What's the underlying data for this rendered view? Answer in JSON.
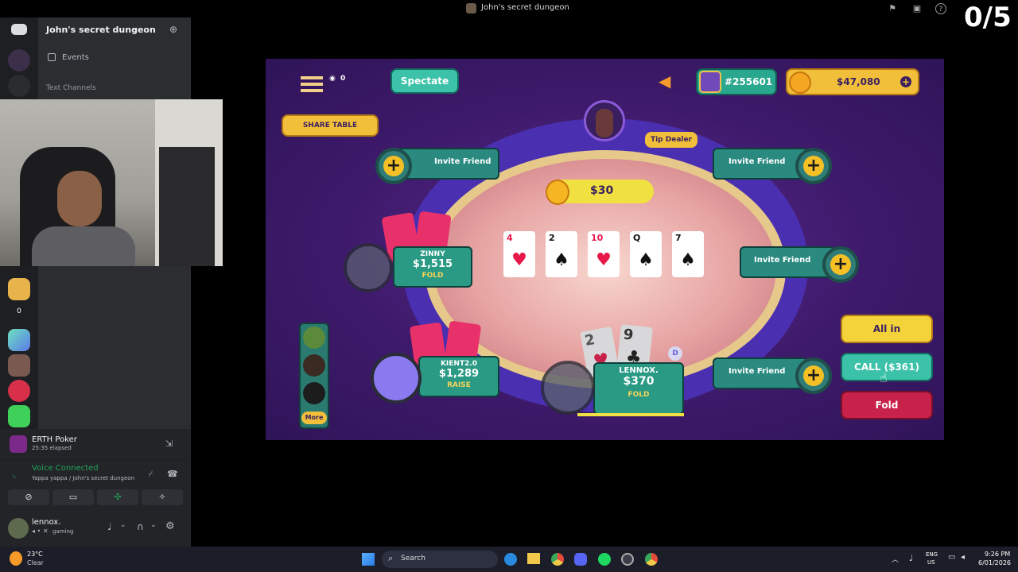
{
  "window": {
    "title": "John's secret dungeon"
  },
  "overlay": {
    "counter": "0/5"
  },
  "discord": {
    "server_name": "John's secret dungeon",
    "events_label": "Events",
    "text_channels_label": "Text Channels",
    "activity": {
      "name": "ERTH Poker",
      "elapsed": "25:35 elapsed"
    },
    "voice": {
      "status": "Voice Connected",
      "channel": "Yappa yappa / John's secret dungeon"
    },
    "user": {
      "name": "lennox.",
      "status": "gaming"
    },
    "rail_count": "0"
  },
  "game": {
    "spectate_label": "Spectate",
    "spectators": "0",
    "share_table_label": "SHARE TABLE",
    "rank": "#255601",
    "balance": "$47,080",
    "tip_dealer_label": "Tip Dealer",
    "pot": "$30",
    "invite_label": "Invite Friend",
    "more_label": "More",
    "community_cards": [
      {
        "rank": "4",
        "suit": "♥",
        "color": "#e8184a"
      },
      {
        "rank": "2",
        "suit": "♠",
        "color": "#111111"
      },
      {
        "rank": "10",
        "suit": "♥",
        "color": "#e8184a"
      },
      {
        "rank": "Q",
        "suit": "♠",
        "color": "#111111"
      },
      {
        "rank": "7",
        "suit": "♠",
        "color": "#111111"
      }
    ],
    "players": {
      "zinny": {
        "name": "ZINNY",
        "stack": "$1,515",
        "action": "FOLD"
      },
      "kient": {
        "name": "KIENT2.0",
        "stack": "$1,289",
        "action": "RAISE"
      },
      "lennox": {
        "name": "LENNOX.",
        "stack": "$370",
        "action": "FOLD",
        "dealer": "D",
        "hand": [
          {
            "rank": "2",
            "suit": "♥"
          },
          {
            "rank": "9",
            "suit": "♣"
          }
        ]
      }
    },
    "actions": {
      "all_in": "All in",
      "call": "CALL ($361)",
      "fold": "Fold"
    }
  },
  "taskbar": {
    "weather_temp": "23°C",
    "weather_desc": "Clear",
    "search_placeholder": "Search",
    "lang_line1": "ENG",
    "lang_line2": "US",
    "time": "9:26 PM",
    "date": "6/01/2026"
  },
  "colors": {
    "accent_yellow": "#f5c026",
    "teal": "#2a9a84",
    "fold_red": "#c8214a",
    "discord_green": "#23a55a"
  }
}
